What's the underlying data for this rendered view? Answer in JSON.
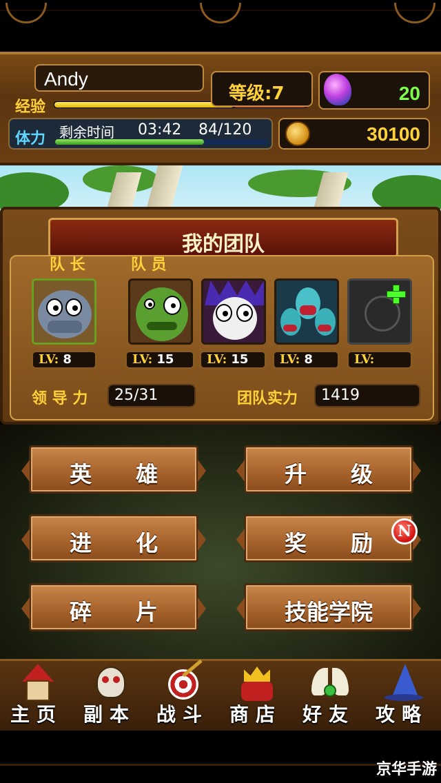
{
  "player": {
    "name": "Andy",
    "exp_label": "经验",
    "exp_progress": 0.71,
    "level_text": "等级:7",
    "stamina_label": "体力",
    "remaining_time_label": "剩余时间",
    "remaining_time": "03:42",
    "stamina_value": "84/120",
    "stamina_progress": 0.7
  },
  "resources": {
    "gems": "20",
    "gold": "30100"
  },
  "team": {
    "title": "我的团队",
    "leader_label": "队 长",
    "members_label": "队 员",
    "lv_prefix": "LV:",
    "leader": {
      "level": "8",
      "icon": "rhino-monster-icon"
    },
    "members": [
      {
        "level": "15",
        "icon": "green-orc-icon"
      },
      {
        "level": "15",
        "icon": "skull-vampire-icon"
      },
      {
        "level": "8",
        "icon": "hydra-icon"
      },
      {
        "level": "",
        "icon": "add-member-icon"
      }
    ],
    "leadership_label": "领 导 力",
    "leadership_value": "25/31",
    "power_label": "团队实力",
    "power_value": "1419"
  },
  "menu": {
    "heroes": "英　　雄",
    "upgrade": "升　　级",
    "evolve": "进　　化",
    "rewards": "奖　　励",
    "fragments": "碎　　片",
    "skill_academy": "技能学院",
    "rewards_badge": "N"
  },
  "tabs": [
    {
      "label": "主页",
      "icon": "house-icon"
    },
    {
      "label": "副本",
      "icon": "skull-icon"
    },
    {
      "label": "战斗",
      "icon": "target-arrow-icon"
    },
    {
      "label": "商店",
      "icon": "crown-shop-icon"
    },
    {
      "label": "好友",
      "icon": "winged-emblem-icon"
    },
    {
      "label": "攻略",
      "icon": "wizard-hat-icon"
    }
  ],
  "watermark": "京华手游",
  "colors": {
    "gold_text": "#ffd23a",
    "gem_text": "#7dff4a",
    "stamina_text": "#5fd6ff"
  }
}
